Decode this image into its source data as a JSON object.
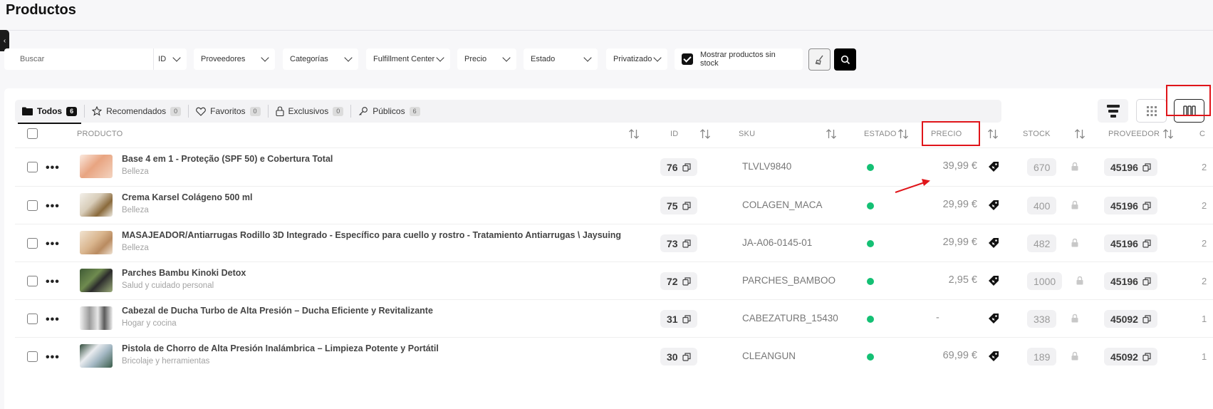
{
  "page": {
    "title": "Productos"
  },
  "filters": {
    "search_placeholder": "Buscar",
    "search_by": "ID",
    "providers": "Proveedores",
    "categories": "Categorías",
    "fulfillment": "Fulfillment Center",
    "price": "Precio",
    "status": "Estado",
    "privatized": "Privatizado",
    "show_no_stock": "Mostrar productos sin stock",
    "show_no_stock_checked": true
  },
  "tabs": [
    {
      "label": "Todos",
      "count": "6",
      "active": true
    },
    {
      "label": "Recomendados",
      "count": "0"
    },
    {
      "label": "Favoritos",
      "count": "0"
    },
    {
      "label": "Exclusivos",
      "count": "0"
    },
    {
      "label": "Públicos",
      "count": "6"
    }
  ],
  "columns": {
    "product": "PRODUCTO",
    "id": "ID",
    "sku": "SKU",
    "status": "ESTADO",
    "price": "PRECIO",
    "stock": "STOCK",
    "provider": "PROVEEDOR",
    "next": "C"
  },
  "rows": [
    {
      "name": "Base 4 em 1 - Proteção (SPF 50) e Cobertura Total",
      "category": "Belleza",
      "id": "76",
      "sku": "TLVLV9840",
      "price": "39,99 €",
      "stock": "670",
      "provider": "45196",
      "next": "2"
    },
    {
      "name": "Crema Karsel Colágeno 500 ml",
      "category": "Belleza",
      "id": "75",
      "sku": "COLAGEN_MACA",
      "price": "29,99 €",
      "stock": "400",
      "provider": "45196",
      "next": "2"
    },
    {
      "name": "MASAJEADOR/Antiarrugas Rodillo 3D Integrado - Específico para cuello y rostro - Tratamiento Antiarrugas \\ Jaysuing",
      "category": "Belleza",
      "id": "73",
      "sku": "JA-A06-0145-01",
      "price": "29,99 €",
      "stock": "482",
      "provider": "45196",
      "next": "2"
    },
    {
      "name": "Parches Bambu Kinoki Detox",
      "category": "Salud y cuidado personal",
      "id": "72",
      "sku": "PARCHES_BAMBOO",
      "price": "2,95 €",
      "stock": "1000",
      "provider": "45196",
      "next": "2"
    },
    {
      "name": "Cabezal de Ducha Turbo de Alta Presión – Ducha Eficiente y Revitalizante",
      "category": "Hogar y cocina",
      "id": "31",
      "sku": "CABEZATURB_15430",
      "price": "-",
      "stock": "338",
      "provider": "45092",
      "next": "1"
    },
    {
      "name": "Pistola de Chorro de Alta Presión Inalámbrica – Limpieza Potente y Portátil",
      "category": "Bricolaje y herramientas",
      "id": "30",
      "sku": "CLEANGUN",
      "price": "69,99 €",
      "stock": "189",
      "provider": "45092",
      "next": "1"
    }
  ],
  "colors": {
    "status_active": "#14c074",
    "highlight": "#e0151a",
    "accent": "#111111"
  }
}
